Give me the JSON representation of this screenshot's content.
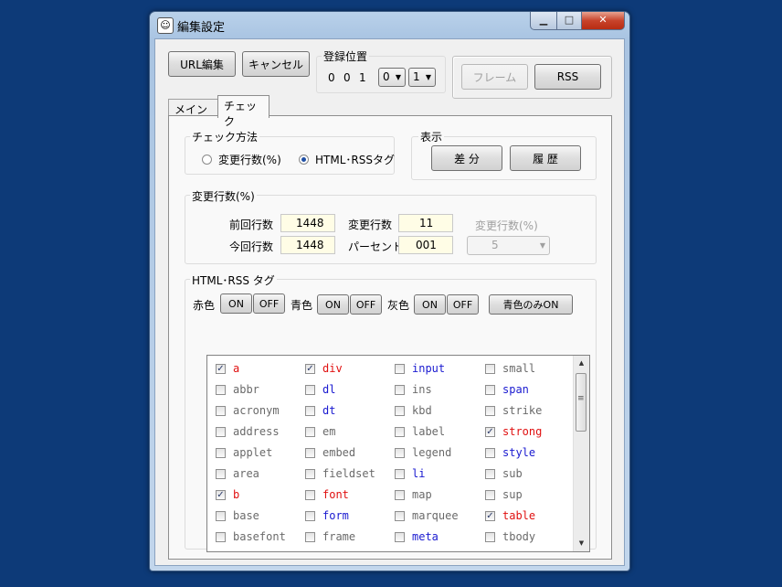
{
  "window": {
    "title": "編集設定",
    "icon": "app-face-icon"
  },
  "caption": {
    "minimize": "▁",
    "maximize": "□",
    "close": "✕"
  },
  "toolbar": {
    "url_edit": "URL編集",
    "cancel": "キャンセル",
    "position_label": "登録位置",
    "position_digits": [
      "0",
      "0",
      "1"
    ],
    "combo1": "0",
    "combo2": "1",
    "frame": "フレーム",
    "rss": "RSS"
  },
  "tabs": [
    "メイン",
    "チェック"
  ],
  "check_method": {
    "label": "チェック方法",
    "option1": "変更行数(%)",
    "option2": "HTML･RSSタグ"
  },
  "display": {
    "label": "表示",
    "diff": "差 分",
    "history": "履 歴"
  },
  "change_lines": {
    "label": "変更行数(%)",
    "prev_label": "前回行数",
    "prev_value": "1448",
    "curr_label": "今回行数",
    "curr_value": "1448",
    "changed_label": "変更行数",
    "changed_value": "11",
    "percent_label": "パーセント",
    "percent_value": "001",
    "threshold_label": "変更行数(%)",
    "threshold_value": "5"
  },
  "tags_group": {
    "label": "HTML･RSS タグ",
    "red": "赤色",
    "blue": "青色",
    "gray": "灰色",
    "on": "ON",
    "off": "OFF",
    "blue_only": "青色のみON"
  },
  "colors": {
    "red": "#e01010",
    "blue": "#1a1ad0",
    "gray": "#6a6a6a"
  },
  "tag_columns": [
    [
      {
        "label": "a",
        "color": "red",
        "checked": true
      },
      {
        "label": "abbr",
        "color": "gray",
        "checked": false
      },
      {
        "label": "acronym",
        "color": "gray",
        "checked": false
      },
      {
        "label": "address",
        "color": "gray",
        "checked": false
      },
      {
        "label": "applet",
        "color": "gray",
        "checked": false
      },
      {
        "label": "area",
        "color": "gray",
        "checked": false
      },
      {
        "label": "b",
        "color": "red",
        "checked": true
      },
      {
        "label": "base",
        "color": "gray",
        "checked": false
      },
      {
        "label": "basefont",
        "color": "gray",
        "checked": false
      }
    ],
    [
      {
        "label": "div",
        "color": "red",
        "checked": true
      },
      {
        "label": "dl",
        "color": "blue",
        "checked": false
      },
      {
        "label": "dt",
        "color": "blue",
        "checked": false
      },
      {
        "label": "em",
        "color": "gray",
        "checked": false
      },
      {
        "label": "embed",
        "color": "gray",
        "checked": false
      },
      {
        "label": "fieldset",
        "color": "gray",
        "checked": false
      },
      {
        "label": "font",
        "color": "red",
        "checked": false
      },
      {
        "label": "form",
        "color": "blue",
        "checked": false
      },
      {
        "label": "frame",
        "color": "gray",
        "checked": false
      }
    ],
    [
      {
        "label": "input",
        "color": "blue",
        "checked": false
      },
      {
        "label": "ins",
        "color": "gray",
        "checked": false
      },
      {
        "label": "kbd",
        "color": "gray",
        "checked": false
      },
      {
        "label": "label",
        "color": "gray",
        "checked": false
      },
      {
        "label": "legend",
        "color": "gray",
        "checked": false
      },
      {
        "label": "li",
        "color": "blue",
        "checked": false
      },
      {
        "label": "map",
        "color": "gray",
        "checked": false
      },
      {
        "label": "marquee",
        "color": "gray",
        "checked": false
      },
      {
        "label": "meta",
        "color": "blue",
        "checked": false
      }
    ],
    [
      {
        "label": "small",
        "color": "gray",
        "checked": false
      },
      {
        "label": "span",
        "color": "blue",
        "checked": false
      },
      {
        "label": "strike",
        "color": "gray",
        "checked": false
      },
      {
        "label": "strong",
        "color": "red",
        "checked": true
      },
      {
        "label": "style",
        "color": "blue",
        "checked": false
      },
      {
        "label": "sub",
        "color": "gray",
        "checked": false
      },
      {
        "label": "sup",
        "color": "gray",
        "checked": false
      },
      {
        "label": "table",
        "color": "red",
        "checked": true
      },
      {
        "label": "tbody",
        "color": "gray",
        "checked": false
      }
    ]
  ]
}
